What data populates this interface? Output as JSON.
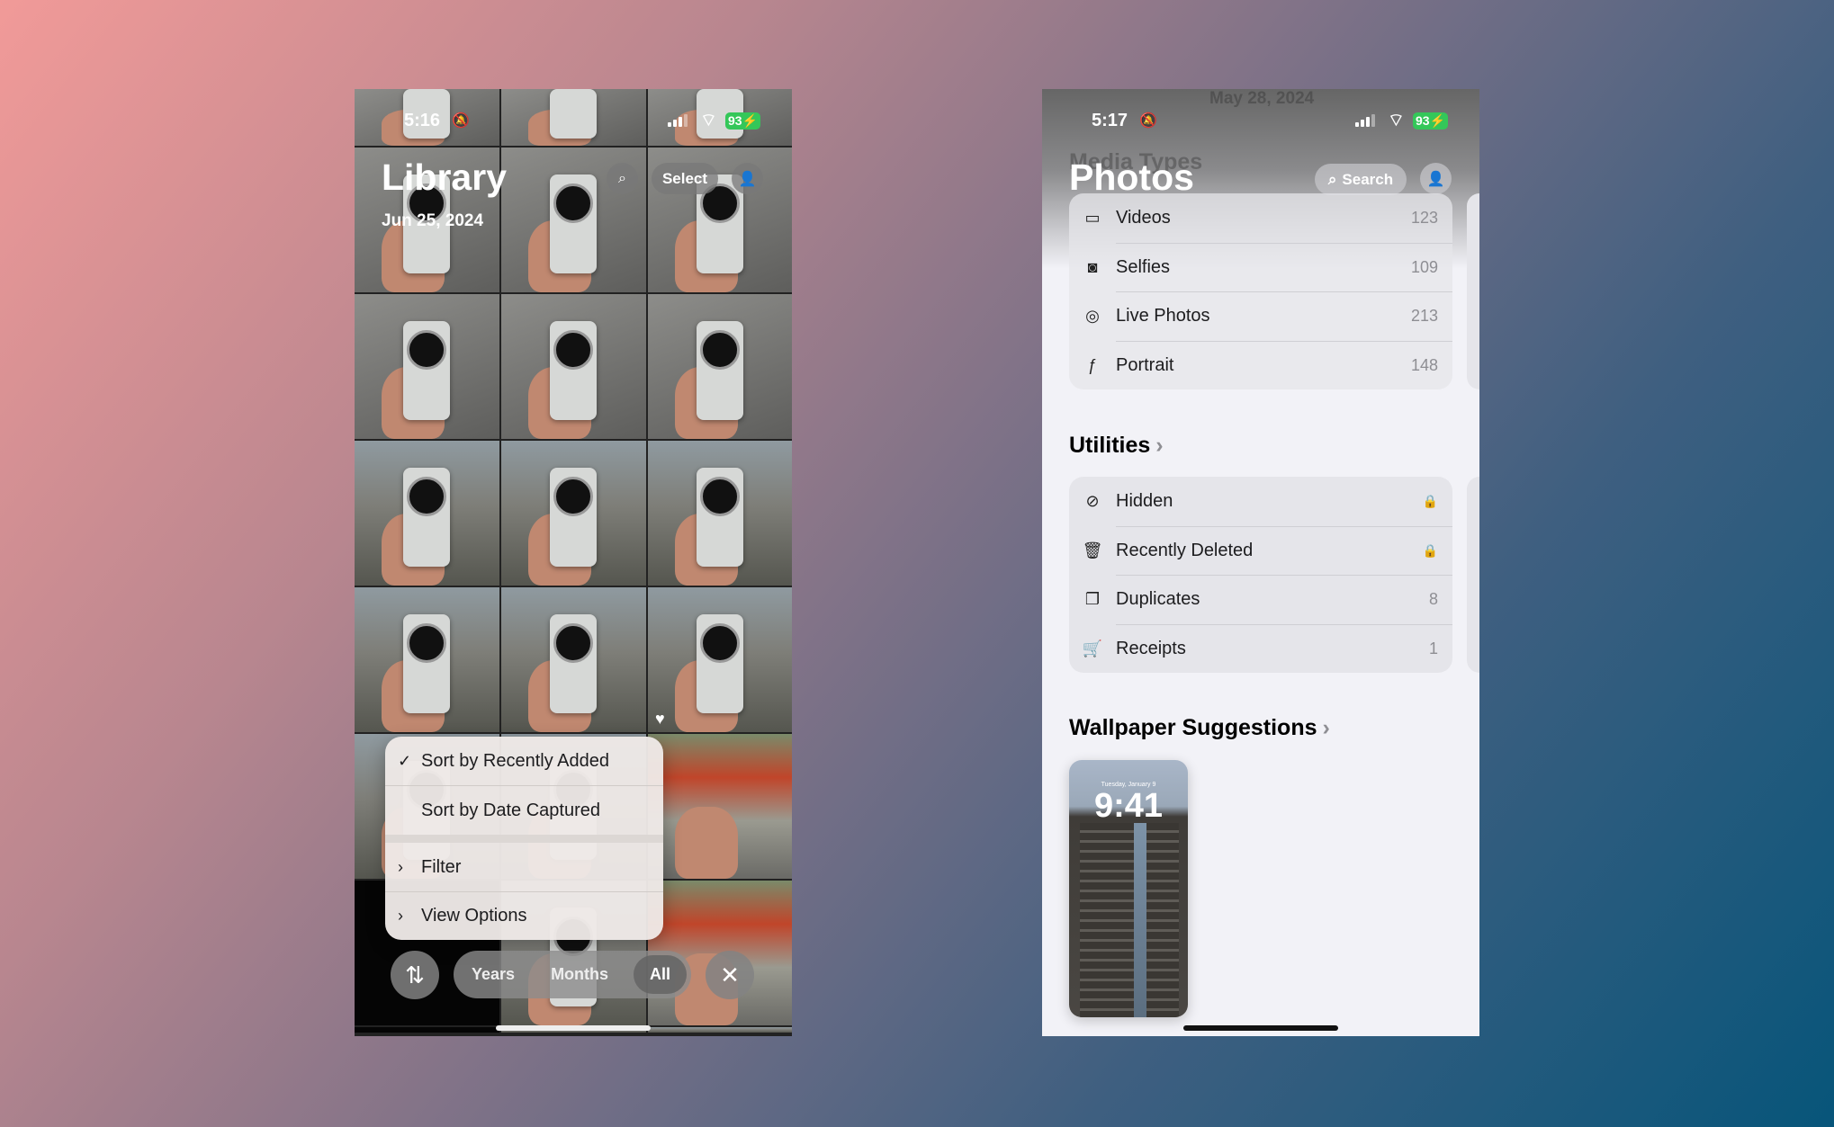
{
  "left_screen": {
    "status": {
      "time": "5:16",
      "battery": "93"
    },
    "title": "Library",
    "date": "Jun 25, 2024",
    "select_label": "Select",
    "menu": {
      "items": [
        {
          "label": "Sort by Recently Added",
          "checked": true
        },
        {
          "label": "Sort by Date Captured",
          "checked": false
        },
        {
          "label": "Filter",
          "submenu": true
        },
        {
          "label": "View Options",
          "submenu": true
        }
      ]
    },
    "segments": {
      "years": "Years",
      "months": "Months",
      "all": "All",
      "selected": "All"
    },
    "icons": {
      "search": "search-icon",
      "profile": "person-icon",
      "sort": "arrow-up-down-icon",
      "close": "close-icon",
      "favorite": "heart-icon"
    }
  },
  "right_screen": {
    "status": {
      "time": "5:17",
      "battery": "93"
    },
    "ghost_date": "May 28, 2024",
    "ghost_heading": "Media Types",
    "title": "Photos",
    "search_label": "Search",
    "media_types": [
      {
        "label": "Videos",
        "count": "123",
        "icon": "video-icon"
      },
      {
        "label": "Selfies",
        "count": "109",
        "icon": "selfie-icon"
      },
      {
        "label": "Live Photos",
        "count": "213",
        "icon": "live-photo-icon"
      },
      {
        "label": "Portrait",
        "count": "148",
        "icon": "portrait-icon"
      }
    ],
    "utilities_heading": "Utilities",
    "utilities": [
      {
        "label": "Hidden",
        "icon": "eye-slash-icon",
        "locked": true
      },
      {
        "label": "Recently Deleted",
        "icon": "trash-icon",
        "locked": true
      },
      {
        "label": "Duplicates",
        "count": "8",
        "icon": "duplicate-icon"
      },
      {
        "label": "Receipts",
        "count": "1",
        "icon": "cart-icon"
      }
    ],
    "wallpaper_heading": "Wallpaper Suggestions",
    "wallpaper": {
      "date": "Tuesday, January 9",
      "time": "9:41"
    }
  },
  "colors": {
    "battery": "#34c759",
    "list_bg": "#e5e5ea",
    "screen_bg": "#f2f2f7"
  }
}
